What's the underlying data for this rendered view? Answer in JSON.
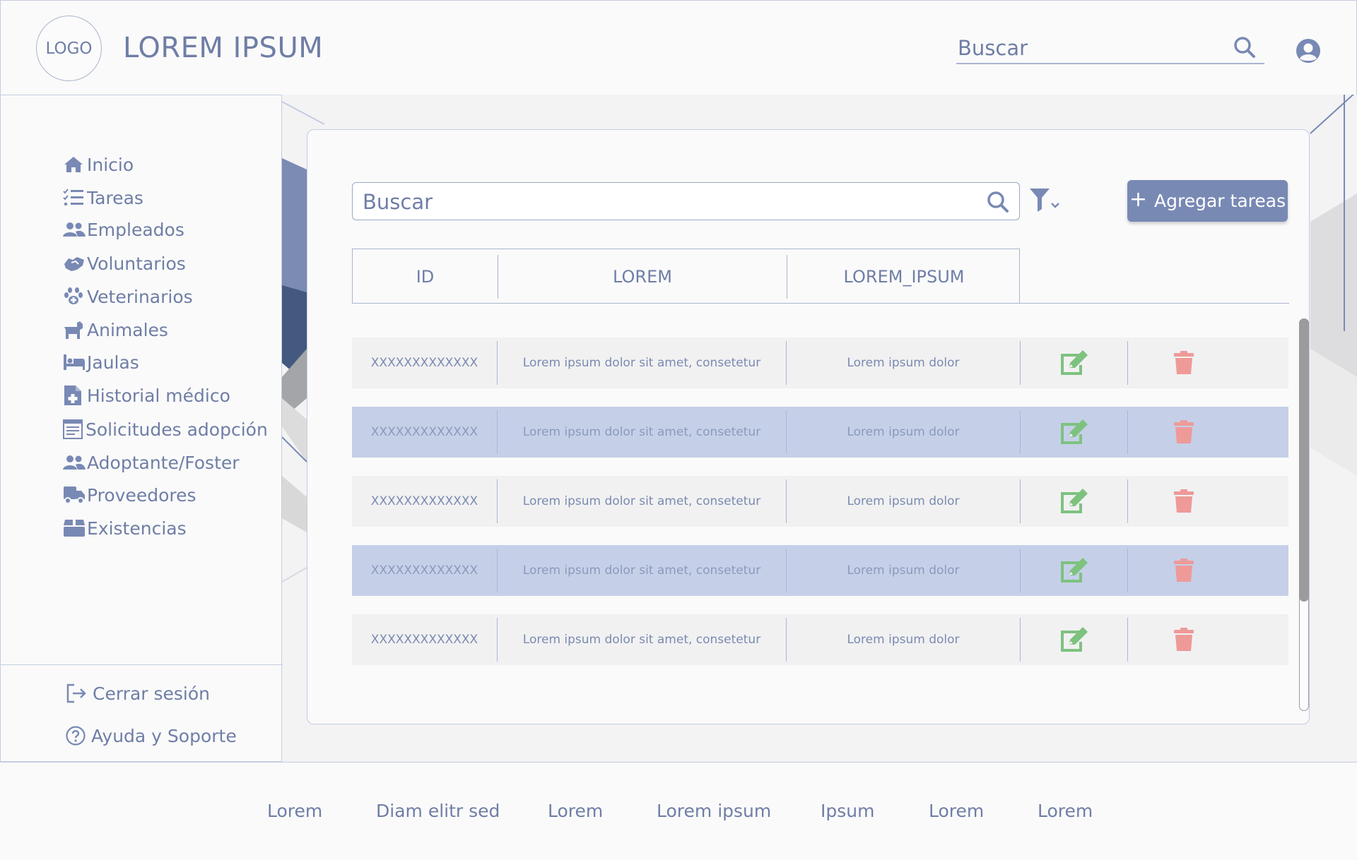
{
  "header": {
    "logo_text": "LOGO",
    "title": "LOREM IPSUM",
    "search_placeholder": "Buscar"
  },
  "sidebar": {
    "items": [
      {
        "label": "Inicio",
        "icon": "home-icon"
      },
      {
        "label": "Tareas",
        "icon": "task-list-icon"
      },
      {
        "label": "Empleados",
        "icon": "people-icon"
      },
      {
        "label": "Voluntarios",
        "icon": "handshake-icon"
      },
      {
        "label": "Veterinarios",
        "icon": "paw-icon"
      },
      {
        "label": "Animales",
        "icon": "dog-icon"
      },
      {
        "label": "Jaulas",
        "icon": "bed-icon"
      },
      {
        "label": "Historial médico",
        "icon": "medical-file-icon"
      },
      {
        "label": "Solicitudes adopción",
        "icon": "form-icon"
      },
      {
        "label": "Adoptante/Foster",
        "icon": "people-icon"
      },
      {
        "label": "Proveedores",
        "icon": "truck-icon"
      },
      {
        "label": "Existencias",
        "icon": "box-icon"
      }
    ],
    "bottom": [
      {
        "label": "Cerrar sesión",
        "icon": "logout-icon"
      },
      {
        "label": "Ayuda y Soporte",
        "icon": "help-icon"
      }
    ]
  },
  "main": {
    "search_placeholder": "Buscar",
    "add_button_label": "Agregar tareas",
    "columns": [
      "ID",
      "LOREM",
      "LOREM_IPSUM"
    ],
    "rows": [
      {
        "id": "XXXXXXXXXXXXX",
        "lorem": "Lorem ipsum dolor sit amet, consetetur",
        "lorem_ipsum": "Lorem ipsum dolor"
      },
      {
        "id": "XXXXXXXXXXXXX",
        "lorem": "Lorem ipsum dolor sit amet, consetetur",
        "lorem_ipsum": "Lorem ipsum dolor"
      },
      {
        "id": "XXXXXXXXXXXXX",
        "lorem": "Lorem ipsum dolor sit amet, consetetur",
        "lorem_ipsum": "Lorem ipsum dolor"
      },
      {
        "id": "XXXXXXXXXXXXX",
        "lorem": "Lorem ipsum dolor sit amet, consetetur",
        "lorem_ipsum": "Lorem ipsum dolor"
      },
      {
        "id": "XXXXXXXXXXXXX",
        "lorem": "Lorem ipsum dolor sit amet, consetetur",
        "lorem_ipsum": "Lorem ipsum dolor"
      }
    ]
  },
  "footer": {
    "links": [
      "Lorem",
      "Diam elitr sed",
      "Lorem",
      "Lorem ipsum",
      "Ipsum",
      "Lorem",
      "Lorem"
    ]
  },
  "colors": {
    "text": "#6f7ea6",
    "accent": "#7889b4",
    "row_highlight": "#c5d0e8",
    "edit": "#7ec27f",
    "delete": "#ee9a98"
  }
}
